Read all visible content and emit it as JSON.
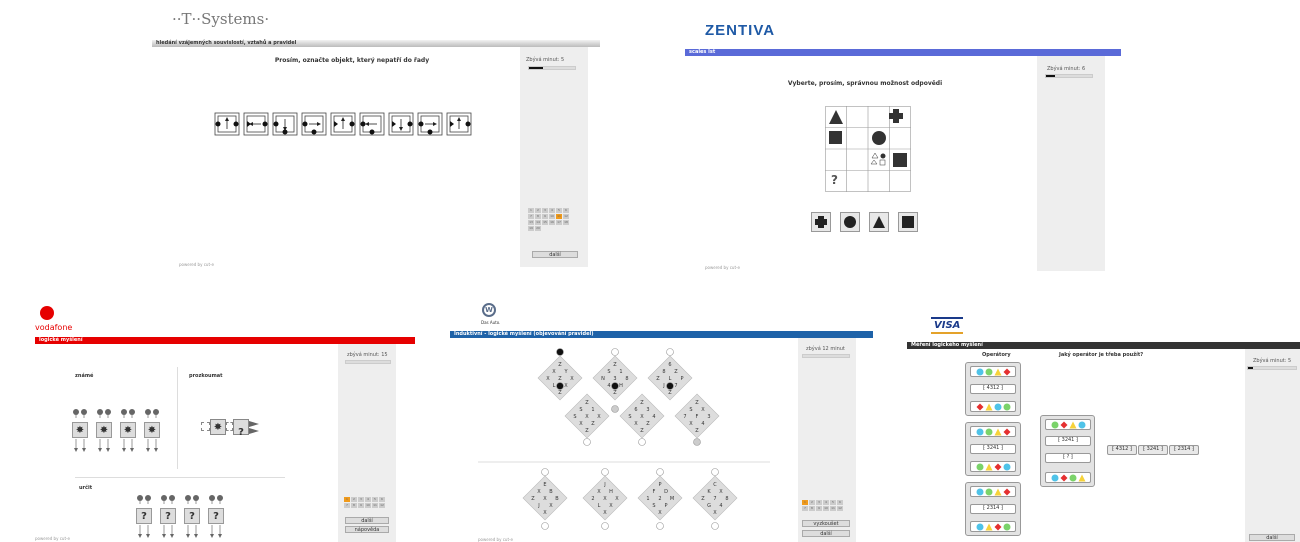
{
  "panels": {
    "tsystems": {
      "logo": "··T··Systems·",
      "header": "hledání vzájemných souvislostí, vztahů a pravidel",
      "instruction": "Prosím, označte objekt, který nepatří do řady",
      "timer_label": "Zbývá minut: 5",
      "timer_progress": 0.3,
      "nav": [
        "1",
        "2",
        "3",
        "4",
        "5",
        "6",
        "7",
        "8",
        "9",
        "10",
        "11",
        "12",
        "13",
        "14",
        "15",
        "16",
        "17",
        "18",
        "19",
        "20"
      ],
      "nav_active": 10,
      "next_label": "další",
      "powered": "powered by cut-e"
    },
    "zentiva": {
      "logo": "ZENTIVA",
      "header": "scales lst",
      "instruction": "Vyberte, prosím, správnou možnost odpovědi",
      "timer_label": "Zbývá minut: 6",
      "timer_progress": 0.2,
      "question_mark": "?",
      "powered": "powered by cut-e"
    },
    "vodafone": {
      "logo": "vodafone",
      "header": "logické myšlení",
      "timer_label": "zbývá minut: 15",
      "timer_progress": 0,
      "known_label": "známé",
      "explore_label": "prozkoumat",
      "determine_label": "určit",
      "question_mark": "?",
      "nav": [
        "1",
        "2",
        "3",
        "4",
        "5",
        "6",
        "7",
        "8",
        "9",
        "10",
        "11",
        "12"
      ],
      "nav_active": 0,
      "next_label": "další",
      "help_label": "nápověda",
      "powered": "powered by cut-e"
    },
    "vw": {
      "logo": "Das Auto.",
      "header": "Induktivní - logické myšlení (objevování pravidel)",
      "timer_label": "zbývá 12 minut",
      "timer_progress": 0,
      "nav": [
        "1",
        "2",
        "3",
        "4",
        "5",
        "6",
        "7",
        "8",
        "9",
        "10",
        "11",
        "12"
      ],
      "nav_active": 0,
      "check_label": "vyzkoušet",
      "next_label": "další",
      "powered": "powered by cut-e",
      "top_diamonds": [
        [
          "Z",
          "X",
          "Y",
          "X",
          "Z",
          "X",
          "L",
          "X",
          "Z"
        ],
        [
          "Z",
          "S",
          "1",
          "N",
          "3",
          "8",
          "4",
          "H",
          "Z"
        ],
        [
          "6",
          "8",
          "Z",
          "Z",
          "L",
          "P",
          "J",
          "7",
          "Z"
        ]
      ],
      "mid_diamonds": [
        [
          "Z",
          "S",
          "1",
          "S",
          "X",
          "X",
          "X",
          "Z",
          "Z"
        ],
        [
          "Z",
          "6",
          "3",
          "S",
          "X",
          "4",
          "X",
          "Z",
          "Z"
        ],
        [
          "Z",
          "S",
          "X",
          "7",
          "F",
          "3",
          "X",
          "4",
          "Z"
        ]
      ],
      "bottom_diamonds": [
        [
          "E",
          "X",
          "B",
          "Z",
          "X",
          "B",
          "J",
          "X",
          "X"
        ],
        [
          "J",
          "X",
          "H",
          "2",
          "X",
          "X",
          "L",
          "X",
          "X"
        ],
        [
          "P",
          "F",
          "D",
          "1",
          "2",
          "M",
          "S",
          "P",
          "X"
        ],
        [
          "C",
          "K",
          "X",
          "Z",
          "7",
          "8",
          "G",
          "4",
          "X"
        ]
      ]
    },
    "visa": {
      "logo": "VISA",
      "header": "Měření logického myšlení",
      "operators_label": "Operátory",
      "question": "Jaký operátor je třeba použít?",
      "timer_label": "Zbývá minut: 5",
      "timer_progress": 0.1,
      "op_codes": [
        "4312",
        "3241",
        "2314"
      ],
      "center_codes": [
        "3241",
        "?"
      ],
      "answer_row": [
        "4312",
        "3241",
        "2314"
      ],
      "next_label": "další"
    }
  }
}
